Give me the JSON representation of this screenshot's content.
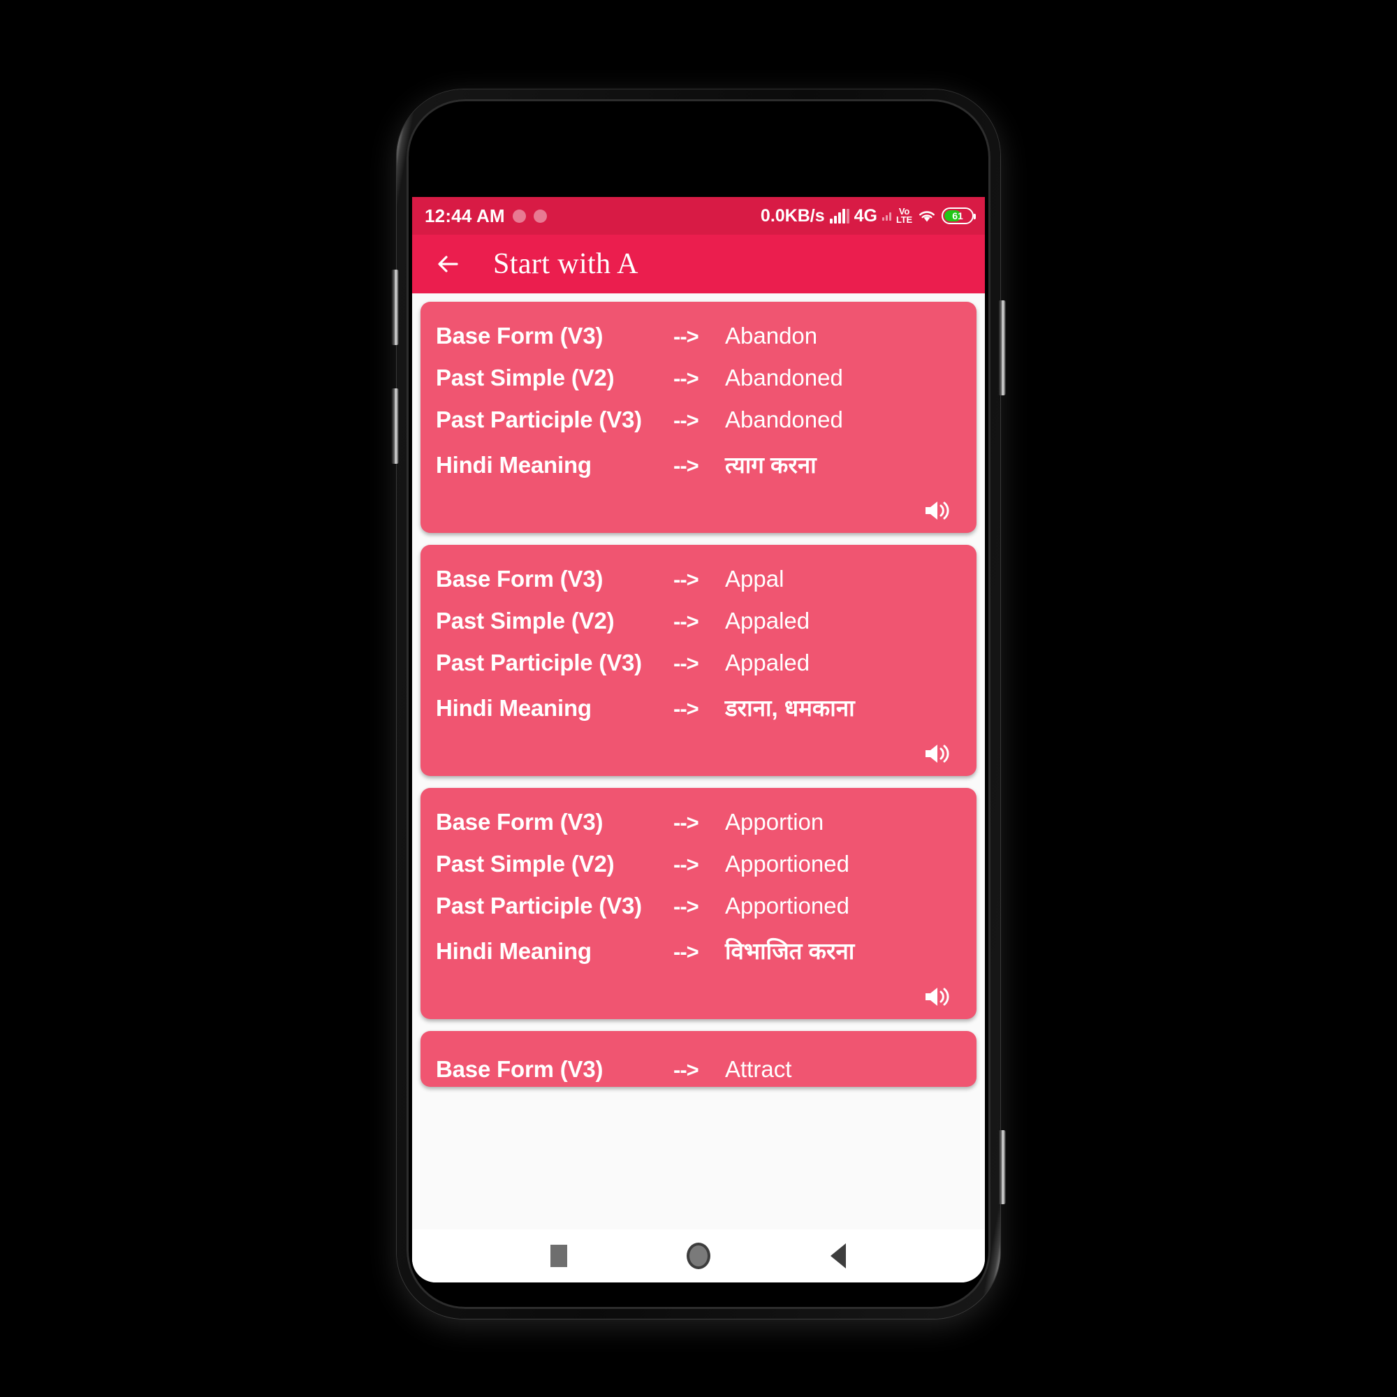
{
  "status_bar": {
    "clock": "12:44 AM",
    "net_speed": "0.0KB/s",
    "network_type": "4G",
    "volte_top": "Vo",
    "volte_bottom": "LTE",
    "battery_level": "61",
    "icons": [
      "signal-bars-icon",
      "volte-icon",
      "wifi-icon",
      "battery-icon"
    ],
    "background_color": "#d81b45"
  },
  "app_bar": {
    "back_label": "←",
    "title": "Start with A",
    "background_color": "#eb1e4e",
    "text_color": "#ffffff"
  },
  "labels": {
    "base_form": "Base Form  (V3)",
    "past_simple": "Past Simple (V2)",
    "past_participle": "Past Participle (V3)",
    "hindi_meaning": "Hindi Meaning",
    "arrow": "-->"
  },
  "theme": {
    "card_color": "#f05571",
    "page_background": "#fafafa",
    "card_text_color": "#ffffff"
  },
  "cards": [
    {
      "base_form": "Abandon",
      "past_simple": "Abandoned",
      "past_participle": "Abandoned",
      "hindi_meaning": "त्याग करना",
      "speaker_icon": "speaker-icon"
    },
    {
      "base_form": "Appal",
      "past_simple": "Appaled",
      "past_participle": "Appaled",
      "hindi_meaning": "डराना, धमकाना",
      "speaker_icon": "speaker-icon"
    },
    {
      "base_form": "Apportion",
      "past_simple": "Apportioned",
      "past_participle": "Apportioned",
      "hindi_meaning": "विभाजित करना",
      "speaker_icon": "speaker-icon"
    },
    {
      "base_form": "Attract",
      "past_simple": "",
      "past_participle": "",
      "hindi_meaning": "",
      "speaker_icon": "speaker-icon",
      "clipped": true
    }
  ],
  "nav_bar": {
    "recents_icon": "square-recents-icon",
    "home_icon": "circle-home-icon",
    "back_icon": "triangle-back-icon",
    "background_color": "#ffffff"
  }
}
